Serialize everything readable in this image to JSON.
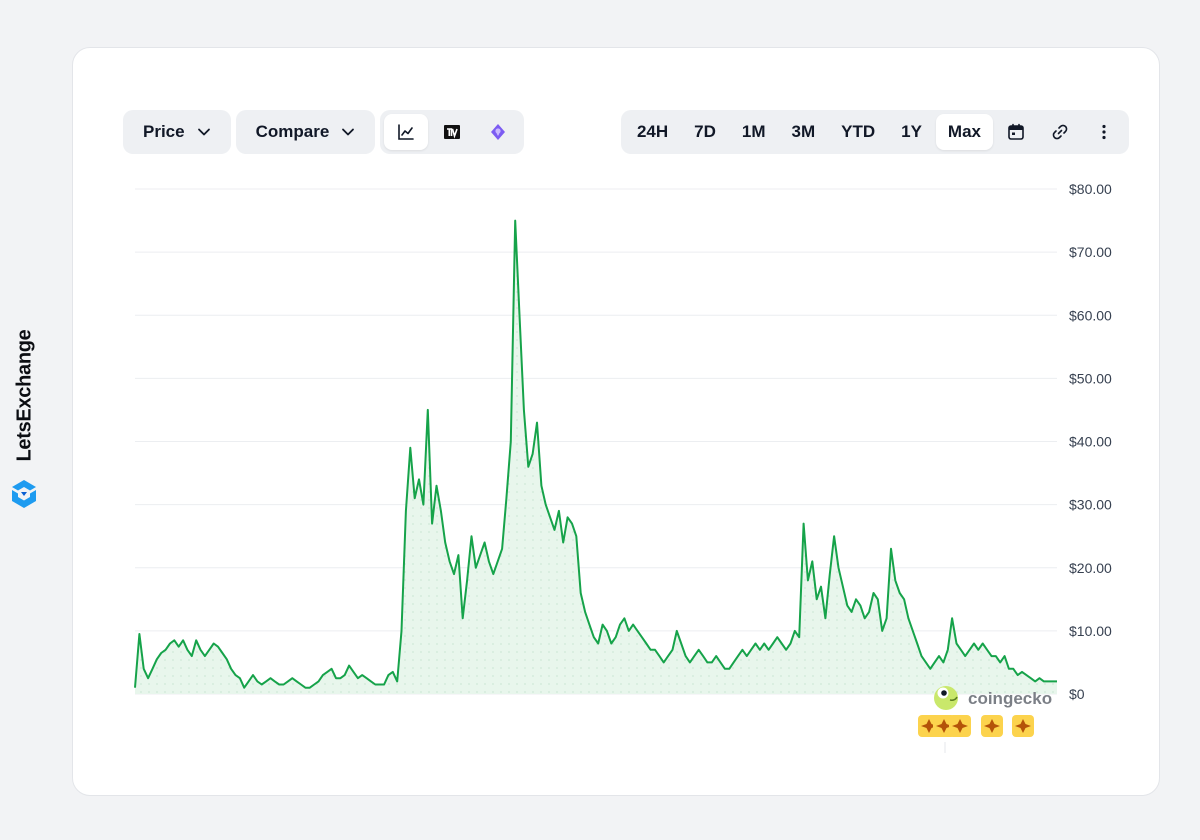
{
  "brand": {
    "name": "LetsExchange"
  },
  "toolbar": {
    "price_label": "Price",
    "compare_label": "Compare",
    "chart_modes": [
      "line-chart-icon",
      "tradingview-icon",
      "ai-insight-icon"
    ],
    "ranges": [
      "24H",
      "7D",
      "1M",
      "3M",
      "YTD",
      "1Y",
      "Max"
    ],
    "active_range": "Max",
    "extra_icons": [
      "calendar-icon",
      "link-icon",
      "more-icon"
    ]
  },
  "watermark": {
    "text": "coingecko"
  },
  "colors": {
    "line": "#16a34a",
    "fill": "#e8f6ec",
    "grid": "#eceef1",
    "accent": "#16a34a"
  },
  "chart_data": {
    "type": "line",
    "title": "",
    "xlabel": "",
    "ylabel": "",
    "ylim": [
      0,
      80
    ],
    "yticks": [
      0,
      10,
      20,
      30,
      40,
      50,
      60,
      70,
      80
    ],
    "ytick_labels": [
      "$0",
      "$10.00",
      "$20.00",
      "$30.00",
      "$40.00",
      "$50.00",
      "$60.00",
      "$70.00",
      "$80.00"
    ],
    "grid": true,
    "series": [
      {
        "values": [
          1,
          9.5,
          4,
          2.5,
          4,
          5.5,
          6.5,
          7,
          8,
          8.5,
          7.5,
          8.5,
          7,
          6,
          8.5,
          7,
          6,
          7,
          8,
          7.5,
          6.5,
          5.5,
          4,
          3,
          2.5,
          1,
          2,
          3,
          2,
          1.5,
          2,
          2.5,
          2,
          1.5,
          1.5,
          2,
          2.5,
          2,
          1.5,
          1,
          1,
          1.5,
          2,
          3,
          3.5,
          4,
          2.5,
          2.5,
          3,
          4.5,
          3.5,
          2.5,
          3,
          2.5,
          2,
          1.5,
          1.5,
          1.5,
          3,
          3.5,
          2,
          10,
          29,
          39,
          31,
          34,
          30,
          45,
          27,
          33,
          29,
          24,
          21,
          19,
          22,
          12,
          18,
          25,
          20,
          22,
          24,
          21,
          19,
          21,
          23,
          31,
          40,
          75,
          60,
          45,
          36,
          38,
          43,
          33,
          30,
          28,
          26,
          29,
          24,
          28,
          27,
          25,
          16,
          13,
          11,
          9,
          8,
          11,
          10,
          8,
          9,
          11,
          12,
          10,
          11,
          10,
          9,
          8,
          7,
          7,
          6,
          5,
          6,
          7,
          10,
          8,
          6,
          5,
          6,
          7,
          6,
          5,
          5,
          6,
          5,
          4,
          4,
          5,
          6,
          7,
          6,
          7,
          8,
          7,
          8,
          7,
          8,
          9,
          8,
          7,
          8,
          10,
          9,
          27,
          18,
          21,
          15,
          17,
          12,
          19,
          25,
          20,
          17,
          14,
          13,
          15,
          14,
          12,
          13,
          16,
          15,
          10,
          12,
          23,
          18,
          16,
          15,
          12,
          10,
          8,
          6,
          5,
          4,
          5,
          6,
          5,
          7,
          12,
          8,
          7,
          6,
          7,
          8,
          7,
          8,
          7,
          6,
          6,
          5,
          6,
          4,
          4,
          3,
          3.5,
          3,
          2.5,
          2,
          2.5,
          2,
          2,
          2,
          2
        ]
      }
    ]
  }
}
